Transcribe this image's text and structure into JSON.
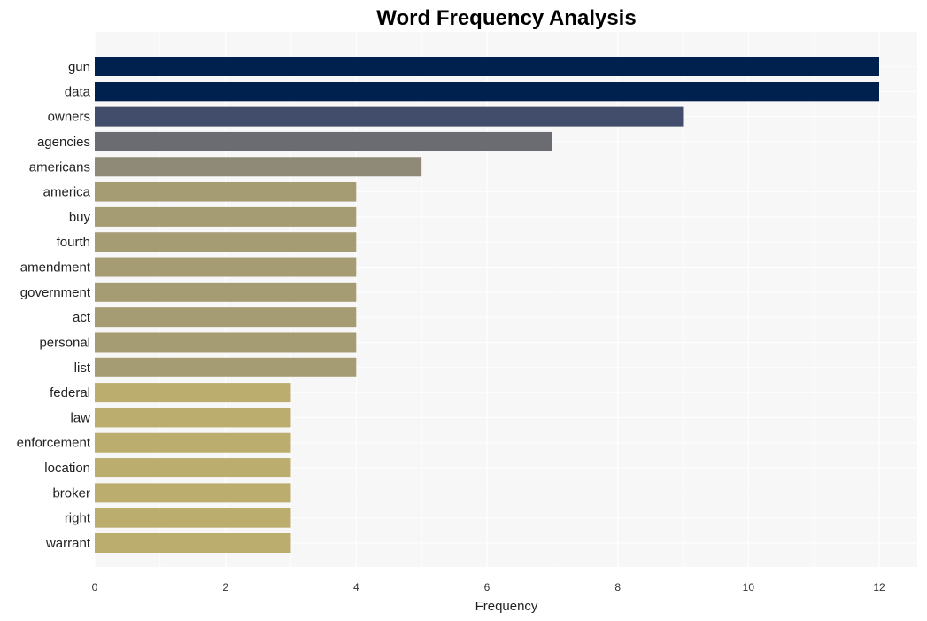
{
  "chart_data": {
    "type": "bar",
    "orientation": "horizontal",
    "title": "Word Frequency Analysis",
    "xlabel": "Frequency",
    "ylabel": "",
    "xlim": [
      0,
      12.6
    ],
    "xticks": [
      0,
      2,
      4,
      6,
      8,
      10,
      12
    ],
    "grid": true,
    "legend": "none",
    "categories": [
      "gun",
      "data",
      "owners",
      "agencies",
      "americans",
      "america",
      "buy",
      "fourth",
      "amendment",
      "government",
      "act",
      "personal",
      "list",
      "federal",
      "law",
      "enforcement",
      "location",
      "broker",
      "right",
      "warrant"
    ],
    "values": [
      12,
      12,
      9,
      7,
      5,
      4,
      4,
      4,
      4,
      4,
      4,
      4,
      4,
      3,
      3,
      3,
      3,
      3,
      3,
      3
    ],
    "colors": [
      "#00204e",
      "#00204e",
      "#414d6b",
      "#6b6b72",
      "#8f8a77",
      "#a59c74",
      "#a59c74",
      "#a59c74",
      "#a59c74",
      "#a59c74",
      "#a59c74",
      "#a59c74",
      "#a59c74",
      "#bbad6e",
      "#bbad6e",
      "#bbad6e",
      "#bbad6e",
      "#bbad6e",
      "#bbad6e",
      "#bbad6e"
    ],
    "background": "#f7f7f7",
    "grid_color": "#ffffff"
  }
}
